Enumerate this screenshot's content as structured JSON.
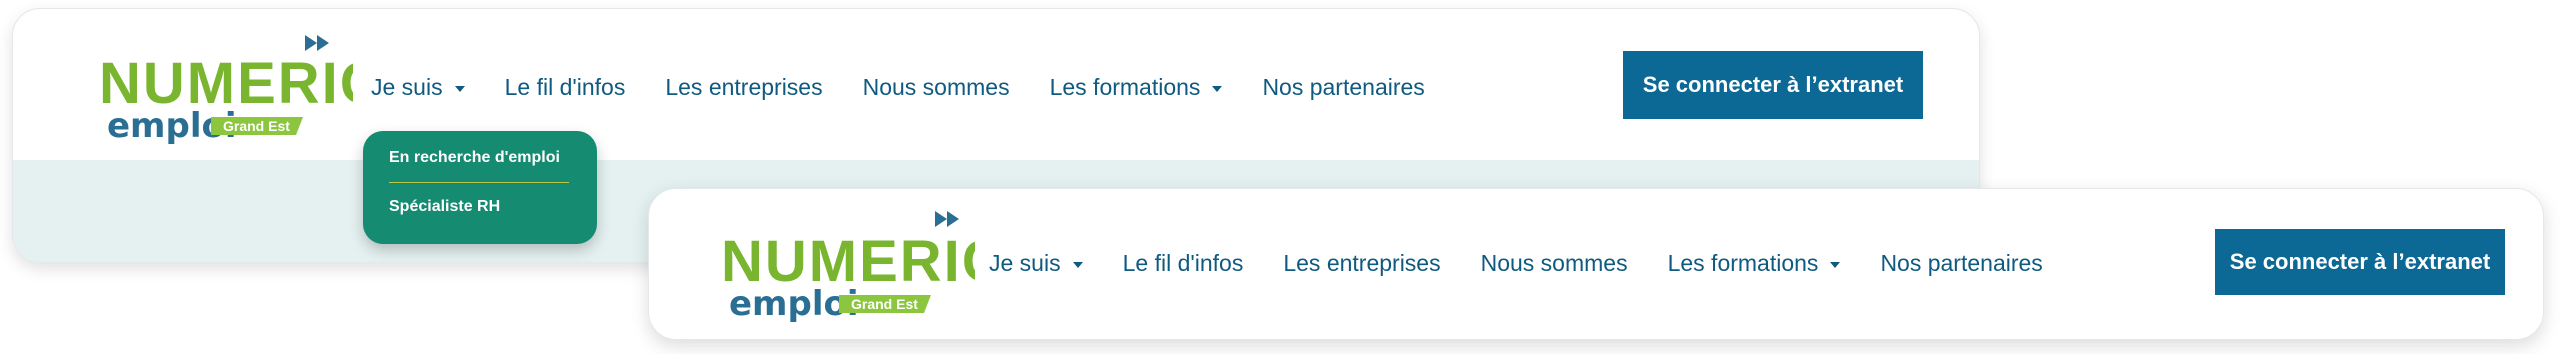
{
  "logo": {
    "word": "NUMERIC",
    "sub": "emploi",
    "badge": "Grand Est",
    "icon": "double-chevron-right-icon"
  },
  "colors": {
    "accent": "#0c6894",
    "nav_text": "#0f5a80",
    "logo_green": "#7ab530",
    "logo_blue": "#2a6f93",
    "dropdown_bg": "#158b72",
    "band_bg": "#e5f1f1"
  },
  "header_top": {
    "nav": {
      "je_suis": "Je suis",
      "fil_infos": "Le fil d'infos",
      "entreprises": "Les entreprises",
      "nous_sommes": "Nous sommes",
      "formations": "Les formations",
      "partenaires": "Nos partenaires"
    },
    "extranet_button": "Se connecter à l’extranet",
    "dropdown": {
      "items": [
        "En recherche d'emploi",
        "Spécialiste RH"
      ]
    }
  },
  "header_bottom": {
    "nav": {
      "je_suis": "Je suis",
      "fil_infos": "Le fil d'infos",
      "entreprises": "Les entreprises",
      "nous_sommes": "Nous sommes",
      "formations": "Les formations",
      "partenaires": "Nos partenaires"
    },
    "extranet_button": "Se connecter à l’extranet"
  }
}
